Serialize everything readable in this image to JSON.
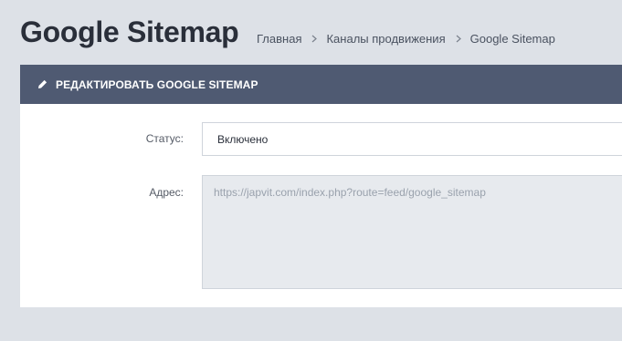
{
  "page": {
    "title": "Google Sitemap"
  },
  "breadcrumb": [
    {
      "label": "Главная"
    },
    {
      "label": "Каналы продвижения"
    },
    {
      "label": "Google Sitemap"
    }
  ],
  "panel": {
    "heading": "РЕДАКТИРОВАТЬ GOOGLE SITEMAP",
    "heading_icon": "pencil-icon"
  },
  "form": {
    "status": {
      "label": "Статус:",
      "value": "Включено"
    },
    "address": {
      "label": "Адрес:",
      "value": "https://japvit.com/index.php?route=feed/google_sitemap"
    }
  },
  "colors": {
    "background": "#dde1e7",
    "panel_heading": "#4f5a72",
    "title_text": "#2a2f3a",
    "readonly_field": "#e7eaee"
  }
}
